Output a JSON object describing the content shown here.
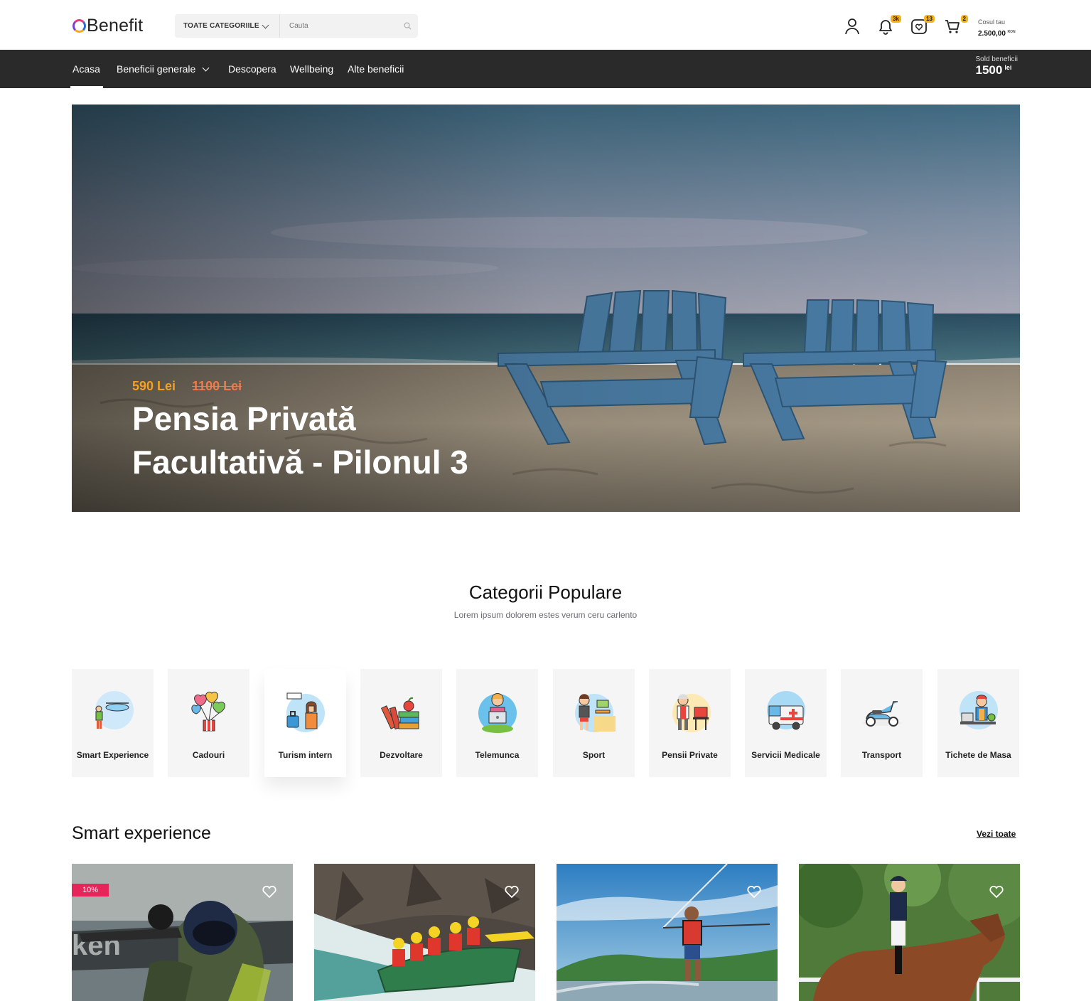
{
  "header": {
    "logo_text": "Benefit",
    "category_select": "TOATE CATEGORIILE",
    "search_placeholder": "Cauta",
    "notifications_badge": "3k",
    "favorites_badge": "13",
    "cart_badge": "2",
    "cart_label": "Cosul tau",
    "cart_amount": "2.500,00",
    "cart_currency": "RON"
  },
  "nav": {
    "items": [
      "Acasa",
      "Beneficii generale",
      "Descopera",
      "Wellbeing",
      "Alte beneficii"
    ],
    "balance_label": "Sold beneficii",
    "balance_value": "1500",
    "balance_unit": "lei"
  },
  "hero": {
    "price_new": "590 Lei",
    "price_old": "1100 Lei",
    "title": "Pensia Privată Facultativă - Pilonul 3"
  },
  "categories": {
    "title": "Categorii Populare",
    "subtitle": "Lorem ipsum dolorem estes verum ceru carlento",
    "items": [
      {
        "label": "Smart Experience",
        "icon": "drone-icon"
      },
      {
        "label": "Cadouri",
        "icon": "balloons-icon"
      },
      {
        "label": "Turism intern",
        "icon": "traveler-icon"
      },
      {
        "label": "Dezvoltare",
        "icon": "books-icon"
      },
      {
        "label": "Telemunca",
        "icon": "remote-work-icon"
      },
      {
        "label": "Sport",
        "icon": "sport-icon"
      },
      {
        "label": "Pensii Private",
        "icon": "retiree-icon"
      },
      {
        "label": "Servicii Medicale",
        "icon": "ambulance-icon"
      },
      {
        "label": "Transport",
        "icon": "scooter-icon"
      },
      {
        "label": "Tichete de Masa",
        "icon": "cashier-icon"
      }
    ]
  },
  "smart_experience": {
    "title": "Smart experience",
    "see_all": "Vezi toate",
    "products": [
      {
        "image": "paintball-photo",
        "discount": "10%"
      },
      {
        "image": "rafting-photo"
      },
      {
        "image": "wakeboard-photo"
      },
      {
        "image": "horse-riding-photo"
      }
    ]
  }
}
